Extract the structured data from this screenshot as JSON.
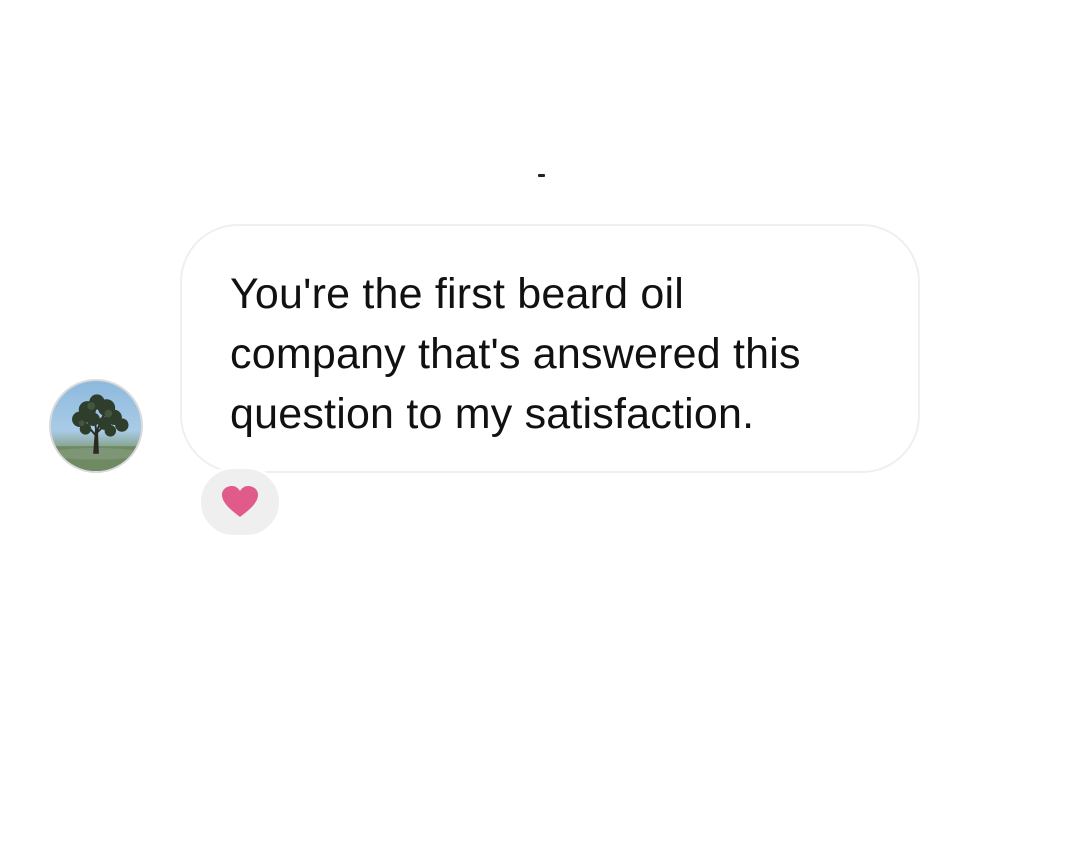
{
  "message": {
    "text": "You're the first beard oil\ncompany that's answered this\nquestion to my satisfaction."
  },
  "avatar": {
    "image": "tree-against-sky"
  },
  "reaction": {
    "icon": "heart-icon",
    "color": "#e05a8a"
  },
  "colors": {
    "bubble_border": "#efefef",
    "reaction_bg": "#efefef",
    "text": "#111111"
  }
}
